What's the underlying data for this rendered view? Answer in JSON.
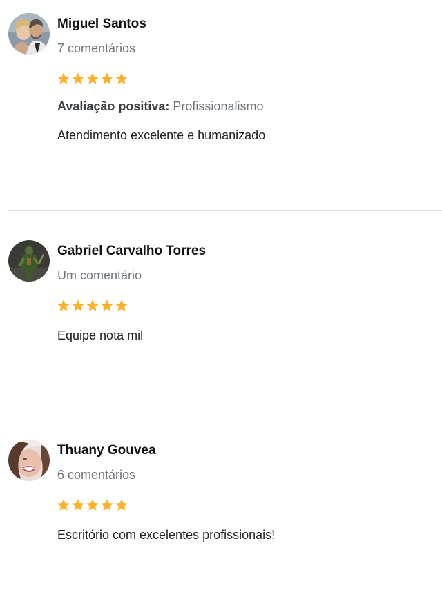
{
  "star_color": "#fbb12a",
  "reviews": [
    {
      "name": "Miguel Santos",
      "comments": "7 comentários",
      "rating": 5,
      "avatar_icon": "profile-photo-couple",
      "positive_label": "Avaliação positiva:",
      "positive_value": "Profissionalismo",
      "text": "Atendimento excelente e humanizado"
    },
    {
      "name": "Gabriel Carvalho Torres",
      "comments": "Um comentário",
      "rating": 5,
      "avatar_icon": "profile-photo-character",
      "text": "Equipe nota mil"
    },
    {
      "name": "Thuany Gouvea",
      "comments": "6 comentários",
      "rating": 5,
      "avatar_icon": "profile-photo-woman",
      "text": "Escritório com excelentes profissionais!"
    }
  ]
}
